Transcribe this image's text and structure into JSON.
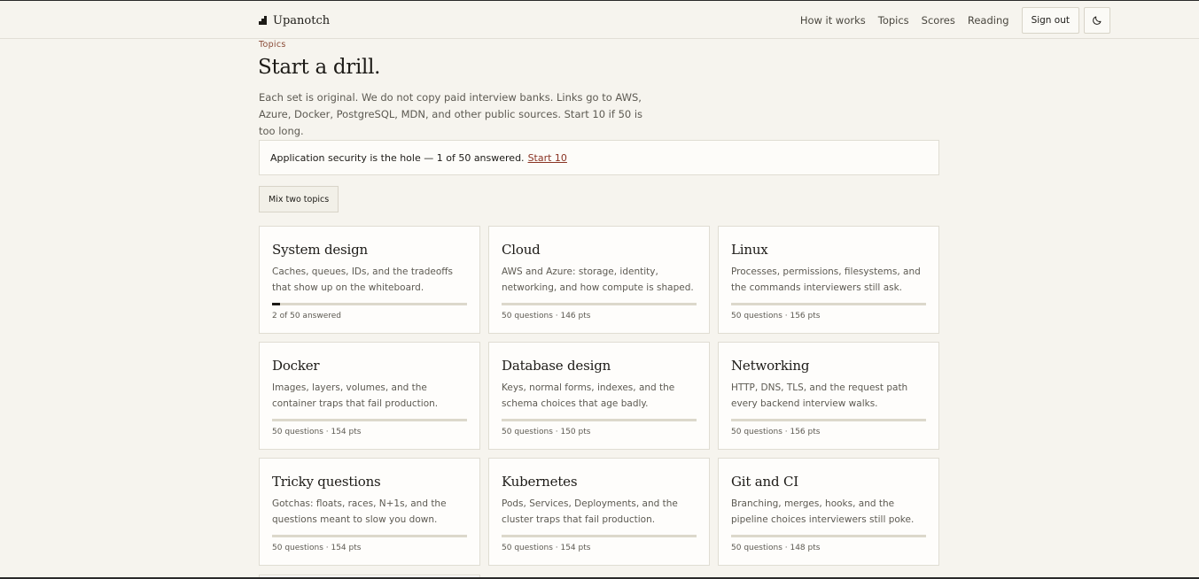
{
  "brand": {
    "name": "Upanotch",
    "icon": "bar-steps-icon"
  },
  "nav": {
    "items": [
      "How it works",
      "Topics",
      "Scores",
      "Reading"
    ],
    "signout_label": "Sign out",
    "theme_icon": "moon-icon"
  },
  "page": {
    "breadcrumb": "Topics",
    "title": "Start a drill.",
    "intro": "Each set is original. We do not copy paid interview banks. Links go to AWS, Azure, Docker, PostgreSQL, MDN, and other public sources. Start 10 if 50 is too long."
  },
  "alert": {
    "text": "Application security is the hole — 1 of 50 answered.",
    "link": "Start 10"
  },
  "mix_label": "Mix two topics",
  "topics": [
    {
      "title": "System design",
      "desc": "Caches, queues, IDs, and the tradeoffs that show up on the whiteboard.",
      "meta": "2 of 50 answered",
      "progress": 0.04
    },
    {
      "title": "Cloud",
      "desc": "AWS and Azure: storage, identity, networking, and how compute is shaped.",
      "meta": "50 questions · 146 pts",
      "progress": 0
    },
    {
      "title": "Linux",
      "desc": "Processes, permissions, filesystems, and the commands interviewers still ask.",
      "meta": "50 questions · 156 pts",
      "progress": 0
    },
    {
      "title": "Docker",
      "desc": "Images, layers, volumes, and the container traps that fail production.",
      "meta": "50 questions · 154 pts",
      "progress": 0
    },
    {
      "title": "Database design",
      "desc": "Keys, normal forms, indexes, and the schema choices that age badly.",
      "meta": "50 questions · 150 pts",
      "progress": 0
    },
    {
      "title": "Networking",
      "desc": "HTTP, DNS, TLS, and the request path every backend interview walks.",
      "meta": "50 questions · 156 pts",
      "progress": 0
    },
    {
      "title": "Tricky questions",
      "desc": "Gotchas: floats, races, N+1s, and the questions meant to slow you down.",
      "meta": "50 questions · 154 pts",
      "progress": 0
    },
    {
      "title": "Kubernetes",
      "desc": "Pods, Services, Deployments, and the cluster traps that fail production.",
      "meta": "50 questions · 154 pts",
      "progress": 0
    },
    {
      "title": "Git and CI",
      "desc": "Branching, merges, hooks, and the pipeline choices interviewers still poke.",
      "meta": "50 questions · 148 pts",
      "progress": 0
    }
  ]
}
